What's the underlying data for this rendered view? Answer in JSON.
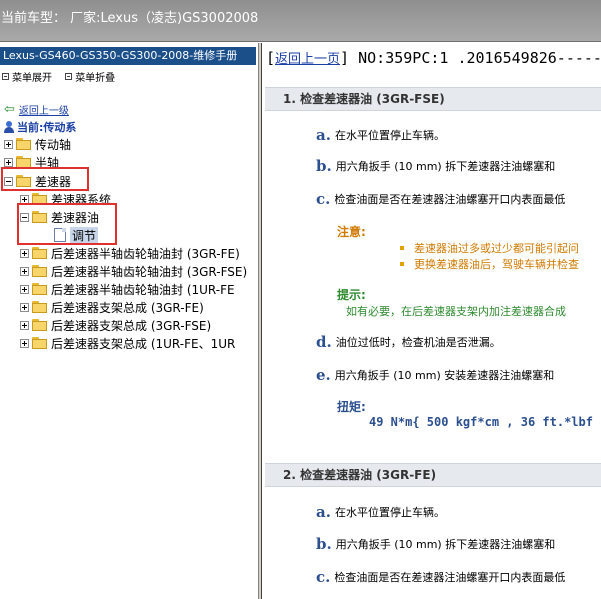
{
  "topbar": {
    "title": "当前车型： 厂家:Lexus（凌志)GS3002008"
  },
  "left": {
    "manual_title": "Lexus-GS460-GS350-GS300-2008-维修手册",
    "menu": {
      "expand": "菜单展开",
      "collapse": "菜单折叠"
    },
    "back": "返回上一级",
    "current": "当前:传动系",
    "tree": [
      {
        "label": "传动轴"
      },
      {
        "label": "半轴"
      },
      {
        "label": "差速器"
      },
      {
        "label": "差速器系统"
      },
      {
        "label": "差速器油"
      },
      {
        "label": "调节"
      },
      {
        "label": "后差速器半轴齿轮轴油封 (3GR-FE)"
      },
      {
        "label": "后差速器半轴齿轮轴油封 (3GR-FSE)"
      },
      {
        "label": "后差速器半轴齿轮轴油封 (1UR-FE"
      },
      {
        "label": "后差速器支架总成 (3GR-FE)"
      },
      {
        "label": "后差速器支架总成 (3GR-FSE)"
      },
      {
        "label": "后差速器支架总成 (1UR-FE、1UR"
      }
    ]
  },
  "right": {
    "nav": {
      "back_link": "返回上一页",
      "doc_id": "] NO:359PC:1 .2016549826-----",
      "bracket": "["
    },
    "section1": {
      "title": "1. 检查差速器油 (3GR-FSE)",
      "steps": [
        {
          "letter": "a.",
          "text": "在水平位置停止车辆。"
        },
        {
          "letter": "b.",
          "text": "用六角扳手 (10 mm) 拆下差速器注油螺塞和"
        },
        {
          "letter": "c.",
          "text": "检查油面是否在差速器注油螺塞开口内表面最低"
        }
      ],
      "notice_label": "注意:",
      "notice_items": [
        "差速器油过多或过少都可能引起问",
        "更换差速器油后，驾驶车辆并检查"
      ],
      "hint_label": "提示:",
      "hint_text": "如有必要，在后差速器支架内加注差速器合成",
      "steps2": [
        {
          "letter": "d.",
          "text": "油位过低时，检查机油是否泄漏。"
        },
        {
          "letter": "e.",
          "text": "用六角扳手 (10 mm) 安装差速器注油螺塞和"
        }
      ],
      "torque_label": "扭矩:",
      "torque_value": "49 N*m{ 500 kgf*cm , 36 ft.*lbf"
    },
    "section2": {
      "title": "2. 检查差速器油 (3GR-FE)",
      "steps": [
        {
          "letter": "a.",
          "text": "在水平位置停止车辆。"
        },
        {
          "letter": "b.",
          "text": "用六角扳手 (10 mm) 拆下差速器注油螺塞和"
        },
        {
          "letter": "c.",
          "text": "检查油面是否在差速器注油螺塞开口内表面最低"
        }
      ]
    }
  },
  "colors": {
    "highlight_box": "#e03030",
    "header_blue": "#1b4f8a",
    "link": "#1a3fa5",
    "notice": "#d07a00",
    "hint": "#2e8b2e"
  }
}
